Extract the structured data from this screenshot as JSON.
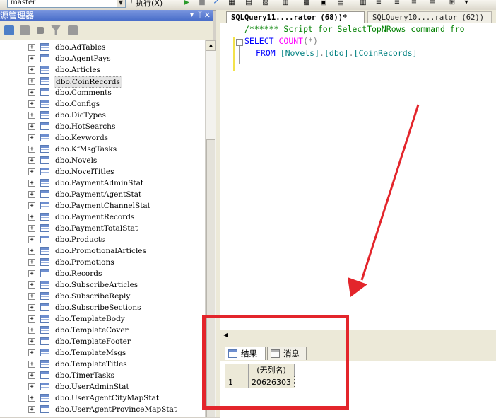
{
  "toolbar": {
    "database": "master",
    "execute_label": "执行(X)"
  },
  "object_explorer": {
    "title": "源管理器",
    "tables": [
      "dbo.AdTables",
      "dbo.AgentPays",
      "dbo.Articles",
      "dbo.CoinRecords",
      "dbo.Comments",
      "dbo.Configs",
      "dbo.DicTypes",
      "dbo.HotSearchs",
      "dbo.Keywords",
      "dbo.KfMsgTasks",
      "dbo.Novels",
      "dbo.NovelTitles",
      "dbo.PaymentAdminStat",
      "dbo.PaymentAgentStat",
      "dbo.PaymentChannelStat",
      "dbo.PaymentRecords",
      "dbo.PaymentTotalStat",
      "dbo.Products",
      "dbo.PromotionalArticles",
      "dbo.Promotions",
      "dbo.Records",
      "dbo.SubscribeArticles",
      "dbo.SubscribeReply",
      "dbo.SubscribeSections",
      "dbo.TemplateBody",
      "dbo.TemplateCover",
      "dbo.TemplateFooter",
      "dbo.TemplateMsgs",
      "dbo.TemplateTitles",
      "dbo.TimerTasks",
      "dbo.UserAdminStat",
      "dbo.UserAgentCityMapStat",
      "dbo.UserAgentProvinceMapStat"
    ],
    "selected_table": "dbo.CoinRecords"
  },
  "editor": {
    "tabs": [
      {
        "label": "SQLQuery11....rator (68))*",
        "active": true
      },
      {
        "label": "SQLQuery10....rator (62))",
        "active": false
      }
    ],
    "code": {
      "line1_comment": "/****** Script for SelectTopNRows command fro",
      "line2_select": "SELECT",
      "line2_func": "COUNT",
      "line2_open": "(",
      "line2_star": "*",
      "line2_close": ")",
      "line3_from": "FROM",
      "line3_obj1": "[Novels]",
      "line3_dot1": ".",
      "line3_obj2": "[dbo]",
      "line3_dot2": ".",
      "line3_obj3": "[CoinRecords]"
    }
  },
  "results": {
    "tabs": [
      "结果",
      "消息"
    ],
    "column_header": "(无列名)",
    "row_number": "1",
    "value": "20626303"
  },
  "annotation": {
    "color": "#e3252b"
  }
}
